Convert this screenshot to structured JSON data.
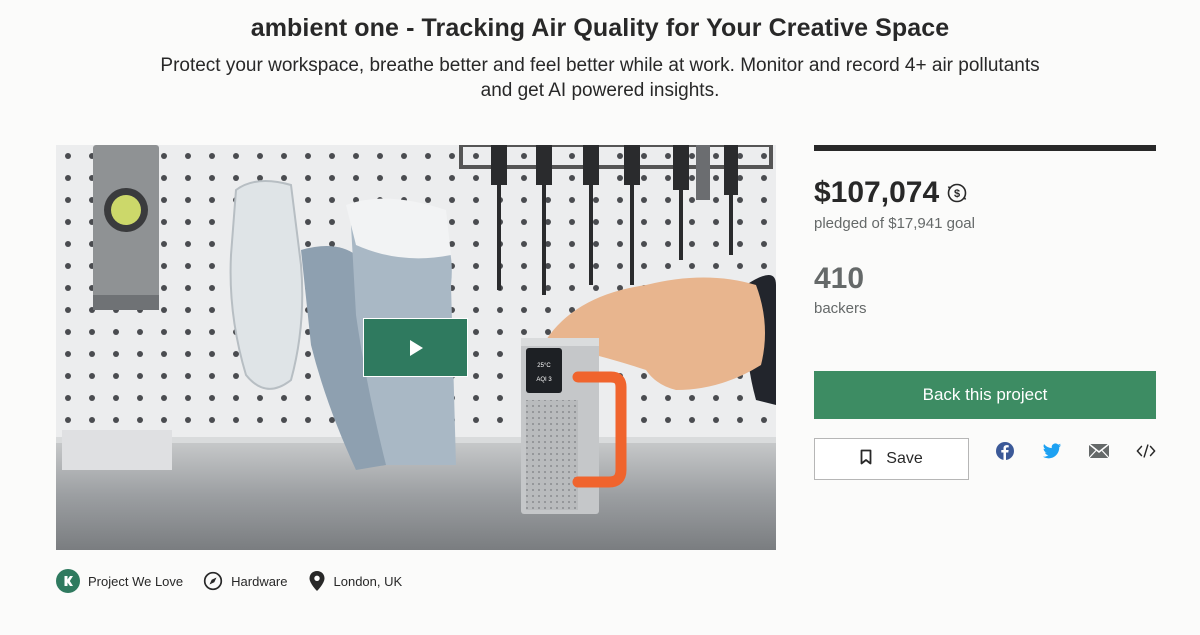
{
  "header": {
    "title": "ambient one - Tracking Air Quality for Your Creative Space",
    "subtitle": "Protect your workspace, breathe better and feel better while at work. Monitor and record 4+ air pollutants and get AI powered insights."
  },
  "video": {
    "play_icon": "play-icon",
    "device_screen_temp": "25°C",
    "device_screen_aqi": "AQI 3"
  },
  "stats": {
    "pledged": "$107,074",
    "pledged_label": "pledged of $17,941 goal",
    "backers": "410",
    "backers_label": "backers",
    "currency_icon": "currency-conversion-icon"
  },
  "actions": {
    "back_label": "Back this project",
    "save_label": "Save",
    "share_icons": [
      "facebook-icon",
      "twitter-icon",
      "email-icon",
      "embed-icon"
    ]
  },
  "tags": [
    {
      "label": "Project We Love",
      "icon": "kickstarter-badge-icon"
    },
    {
      "label": "Hardware",
      "icon": "compass-icon"
    },
    {
      "label": "London, UK",
      "icon": "location-pin-icon"
    }
  ],
  "colors": {
    "accent": "#3d8c63",
    "play_button": "#2f7a5f",
    "text": "#282828",
    "muted": "#656969",
    "facebook": "#3b5998",
    "twitter": "#1da1f2"
  }
}
